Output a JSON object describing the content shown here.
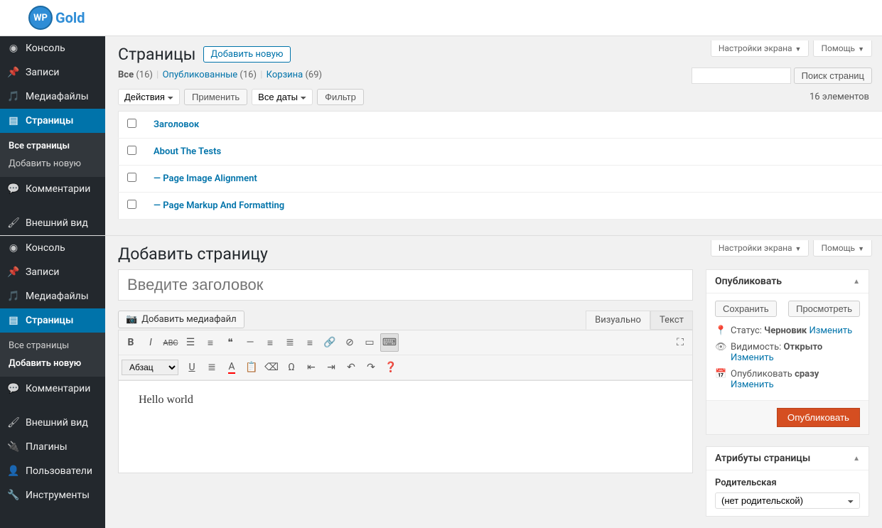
{
  "brand": {
    "badge": "WP",
    "name": "Gold"
  },
  "screenMeta": {
    "options": "Настройки экрана",
    "help": "Помощь"
  },
  "nav": {
    "dashboard": "Консоль",
    "posts": "Записи",
    "media": "Медиафайлы",
    "pages": "Страницы",
    "comments": "Комментарии",
    "appearance": "Внешний вид",
    "plugins": "Плагины",
    "users": "Пользователи",
    "tools": "Инструменты"
  },
  "sub": {
    "all": "Все страницы",
    "addNew": "Добавить новую"
  },
  "listPage": {
    "heading": "Страницы",
    "addNew": "Добавить новую",
    "filters": {
      "allLabel": "Все",
      "allCount": "(16)",
      "publishedLabel": "Опубликованные",
      "publishedCount": "(16)",
      "trashLabel": "Корзина",
      "trashCount": "(69)"
    },
    "bulkAction": "Действия",
    "apply": "Применить",
    "dateFilter": "Все даты",
    "filterBtn": "Фильтр",
    "searchBtn": "Поиск страниц",
    "itemsCount": "16 элементов",
    "columnTitle": "Заголовок",
    "rows": [
      {
        "title": "About The Tests"
      },
      {
        "title": "— Page Image Alignment"
      },
      {
        "title": "— Page Markup And Formatting"
      }
    ]
  },
  "editor": {
    "heading": "Добавить страницу",
    "titlePlaceholder": "Введите заголовок",
    "addMedia": "Добавить медиафайл",
    "tabVisual": "Визуально",
    "tabText": "Текст",
    "paragraph": "Абзац",
    "content": "Hello world"
  },
  "publish": {
    "boxTitle": "Опубликовать",
    "saveDraft": "Сохранить",
    "preview": "Просмотреть",
    "statusLabel": "Статус:",
    "statusValue": "Черновик",
    "edit": "Изменить",
    "visibilityLabel": "Видимость:",
    "visibilityValue": "Открыто",
    "scheduleLabel": "Опубликовать",
    "scheduleValue": "сразу",
    "publishBtn": "Опубликовать"
  },
  "attributes": {
    "boxTitle": "Атрибуты страницы",
    "parentLabel": "Родительская",
    "parentValue": "(нет родительской)"
  }
}
